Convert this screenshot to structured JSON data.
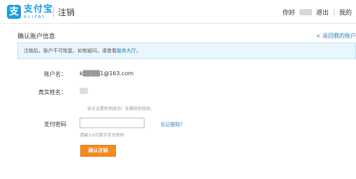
{
  "header": {
    "logo_mark": "支",
    "logo_cn": "支付宝",
    "logo_en": "ALIPAY",
    "title": "注销",
    "greeting": "你好",
    "logout": "退出",
    "more": "我的"
  },
  "page": {
    "section_title": "确认账户信息",
    "back_link": "< 返回我的账户"
  },
  "notice": {
    "text": "注销后，账户不可恢复。如有疑问，请查看",
    "link": "服务大厅。"
  },
  "form": {
    "account_label": "账户名：",
    "account_value": "k▒▒▒▒1@163.com",
    "realname_label": "真实姓名：",
    "security_hint": "安全设置检测成功！无需短信校验。",
    "password_label": "支付密码",
    "password_value": "",
    "forgot_link": "忘记密码？",
    "password_hint": "请输入6位数字支付密码",
    "confirm_button": "确认注销"
  },
  "colors": {
    "brand": "#1a9be6",
    "link": "#2a7ab0",
    "button": "#f58a22",
    "notice_bg": "#eaf6fd"
  }
}
